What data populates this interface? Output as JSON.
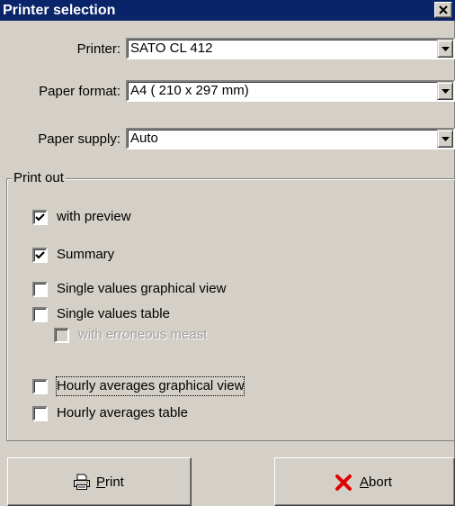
{
  "window": {
    "title": "Printer selection"
  },
  "printer": {
    "label": "Printer:",
    "value": "SATO CL 412"
  },
  "paper_format": {
    "label": "Paper format:",
    "value": "A4 ( 210 x 297 mm)"
  },
  "paper_supply": {
    "label": "Paper supply:",
    "value": "Auto"
  },
  "print_out": {
    "legend": "Print out",
    "options": [
      {
        "label": "with preview",
        "checked": true,
        "enabled": true
      },
      {
        "label": "Summary",
        "checked": true,
        "enabled": true
      },
      {
        "label": "Single values graphical view",
        "checked": false,
        "enabled": true
      },
      {
        "label": "Single values table",
        "checked": false,
        "enabled": true
      },
      {
        "label": "with erroneous meast",
        "checked": false,
        "enabled": false
      },
      {
        "label": "Hourly averages graphical view",
        "checked": false,
        "enabled": true
      },
      {
        "label": "Hourly averages table",
        "checked": false,
        "enabled": true
      }
    ]
  },
  "buttons": {
    "print": {
      "accel": "P",
      "rest": "rint",
      "icon": "printer-icon"
    },
    "abort": {
      "accel": "A",
      "rest": "bort",
      "icon": "red-x-icon"
    }
  }
}
